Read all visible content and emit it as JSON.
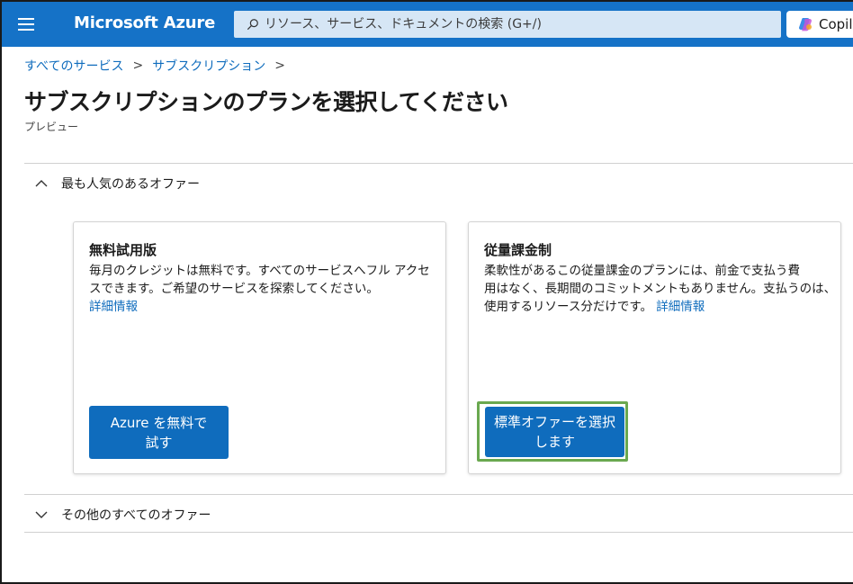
{
  "topbar": {
    "brand": "Microsoft Azure",
    "search_placeholder": "リソース、サービス、ドキュメントの検索 (G+/)",
    "copilot_label": "Copil"
  },
  "breadcrumb": {
    "items": [
      "すべてのサービス",
      "サブスクリプション"
    ],
    "separator": ">"
  },
  "page": {
    "title": "サブスクリプションのプランを選択してください",
    "more": "...",
    "subtitle": "プレビュー"
  },
  "popular_section": {
    "label": "最も人気のあるオファー",
    "expanded": true
  },
  "cards": [
    {
      "title": "無料試用版",
      "desc_line1": "毎月のクレジットは無料です。すべてのサービスへフル アクセ",
      "desc_line2": "スできます。ご希望のサービスを探索してください。",
      "link": "詳細情報",
      "button_line1": "Azure を無料で",
      "button_line2": "試す"
    },
    {
      "title": "従量課金制",
      "desc_line1": "柔軟性があるこの従量課金のプランには、前金で支払う費",
      "desc_line2": "用はなく、長期間のコミットメントもありません。支払うのは、",
      "desc_line3": "使用するリソース分だけです。",
      "link": "詳細情報",
      "button_line1": "標準オファーを選択",
      "button_line2": "します"
    }
  ],
  "other_section": {
    "label": "その他のすべてのオファー",
    "expanded": false
  },
  "colors": {
    "topbar": "#1572c7",
    "accent": "#0f6cbd",
    "highlight": "#6aa84f"
  }
}
